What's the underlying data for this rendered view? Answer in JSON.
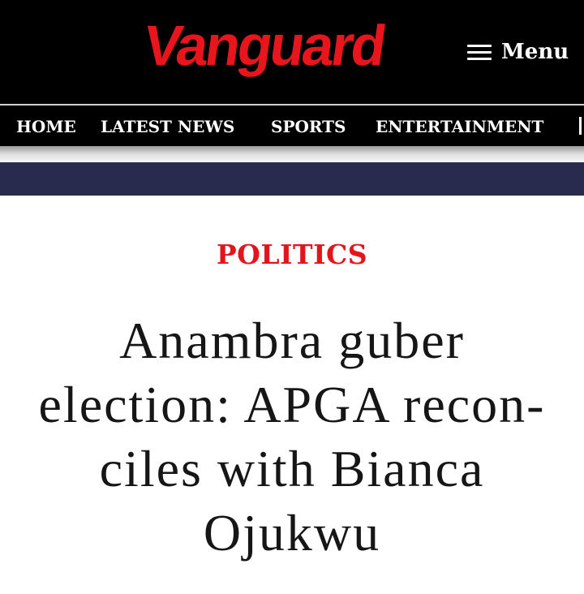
{
  "header": {
    "logo_text": "Vanguard",
    "menu_label": "Menu",
    "brand_color": "#e8161c"
  },
  "nav": {
    "items": [
      {
        "label": "HOME"
      },
      {
        "label": "LATEST NEWS"
      },
      {
        "label": "SPORTS"
      },
      {
        "label": "ENTERTAINMENT"
      }
    ]
  },
  "article": {
    "category": "POLITICS",
    "headline_lines": [
      "Anambra guber",
      "election: APGA recon-",
      "ciles with Bianca",
      "Ojukwu"
    ]
  }
}
